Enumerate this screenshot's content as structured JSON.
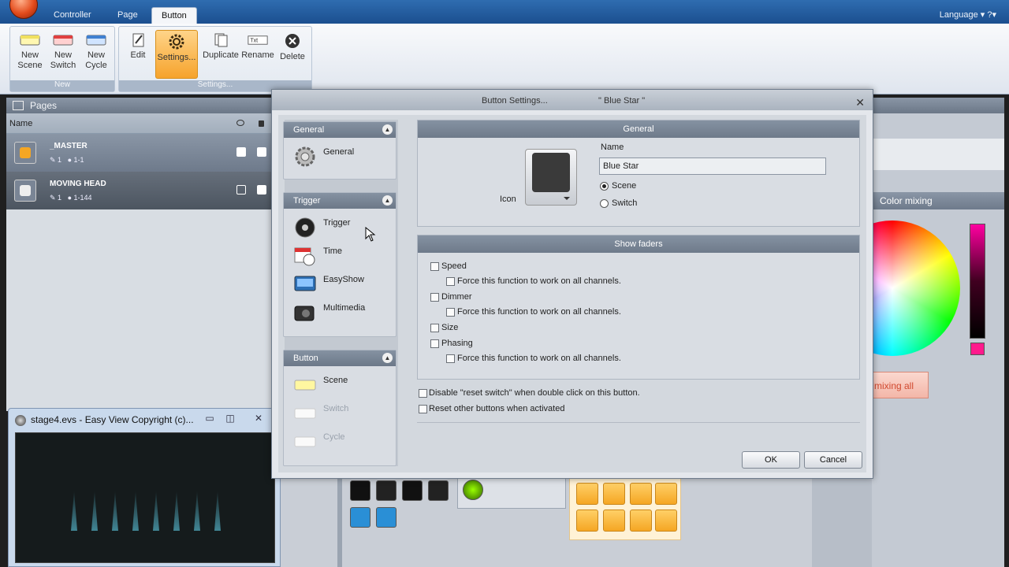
{
  "ribbon": {
    "tabs": [
      "Controller",
      "Page",
      "Button"
    ],
    "language": "Language ▾ ?▾",
    "groups": {
      "new": {
        "label": "New",
        "buttons": [
          {
            "line1": "New",
            "line2": "Scene"
          },
          {
            "line1": "New",
            "line2": "Switch"
          },
          {
            "line1": "New",
            "line2": "Cycle"
          }
        ]
      },
      "settings": {
        "label": "Settings...",
        "buttons": [
          "Edit",
          "Settings...",
          "Duplicate",
          "Rename",
          "Delete"
        ],
        "rename_icon_text": "Txt"
      }
    }
  },
  "pages_panel": {
    "title": "Pages",
    "column_name": "Name",
    "rows": [
      {
        "name": "_MASTER",
        "count": "1",
        "range": "1-1"
      },
      {
        "name": "MOVING HEAD",
        "count": "1",
        "range": "1-144"
      }
    ]
  },
  "color_panel": {
    "title": "Color mixing",
    "button_partial": "mixing all"
  },
  "easy_view": {
    "title": "stage4.evs - Easy View   Copyright (c)..."
  },
  "dialog": {
    "title_left": "Button  Settings...",
    "title_right": "\" Blue Star \"",
    "nav": {
      "general": {
        "header": "General",
        "items": [
          "General"
        ]
      },
      "trigger": {
        "header": "Trigger",
        "items": [
          "Trigger",
          "Time",
          "EasyShow",
          "Multimedia"
        ]
      },
      "button": {
        "header": "Button",
        "items": [
          "Scene",
          "Switch",
          "Cycle"
        ]
      }
    },
    "general_panel": {
      "header": "General",
      "name_label": "Name",
      "name_value": "Blue Star",
      "icon_label": "Icon",
      "type_options": [
        {
          "label": "Scene",
          "selected": true
        },
        {
          "label": "Switch",
          "selected": false
        }
      ]
    },
    "faders_panel": {
      "header": "Show faders",
      "items": [
        {
          "label": "Speed",
          "force": "Force this function to work on all channels."
        },
        {
          "label": "Dimmer",
          "force": "Force this function to work on all channels."
        },
        {
          "label": "Size"
        },
        {
          "label": "Phasing",
          "force": "Force this function to work on all channels."
        }
      ]
    },
    "options": [
      "Disable \"reset switch\" when double click on this button.",
      "Reset other buttons when activated"
    ],
    "ok_label": "OK",
    "cancel_label": "Cancel"
  },
  "colors": {
    "accent_orange": "#f6a32c",
    "header_gray": "#7a8696",
    "title_blue": "#1b4f8f"
  }
}
